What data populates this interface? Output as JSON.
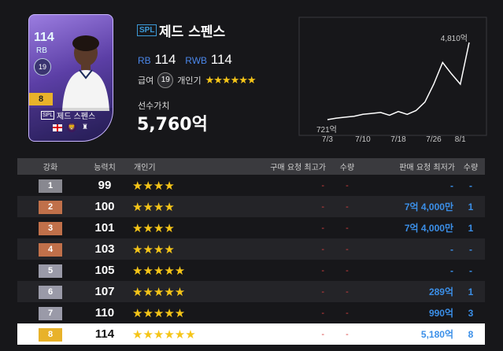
{
  "player": {
    "ovr": "114",
    "pos": "RB",
    "pay": "19",
    "grade": "8",
    "season": "SPL",
    "name": "제드 스펜스",
    "positions": [
      {
        "label": "RB",
        "value": "114"
      },
      {
        "label": "RWB",
        "value": "114"
      }
    ],
    "pay_label": "급여",
    "popularity_label": "개인기",
    "popularity_stars": "★★★★★★",
    "value_label": "선수가치",
    "value": "5,760억",
    "icons": [
      "england-flag-icon",
      "premier-league-icon",
      "tottenham-crest-icon"
    ]
  },
  "chart_data": {
    "type": "line",
    "x": [
      "7/3",
      "7/5",
      "7/7",
      "7/9",
      "7/10",
      "7/12",
      "7/14",
      "7/16",
      "7/18",
      "7/20",
      "7/22",
      "7/24",
      "7/26",
      "7/28",
      "7/30",
      "8/1",
      "8/2"
    ],
    "values": [
      721,
      800,
      850,
      900,
      1000,
      1050,
      1100,
      950,
      1150,
      1000,
      1200,
      1650,
      2600,
      3750,
      3150,
      2600,
      4810
    ],
    "xticks": [
      "7/3",
      "7/10",
      "7/18",
      "7/26",
      "8/1"
    ],
    "annotations": [
      {
        "label": "721억"
      },
      {
        "label": "4,810억"
      }
    ],
    "line_color": "#ffffff",
    "ylim": [
      0,
      5200
    ],
    "grid": false
  },
  "table": {
    "headers": [
      "강화",
      "능력치",
      "개인기",
      "구매 요청 최고가",
      "수량",
      "판매 요청 최저가",
      "수량"
    ],
    "rows": [
      {
        "grade": "1",
        "color": "#888890",
        "ability": "99",
        "stars": "★★★★",
        "buy": "-",
        "buy_qty": "-",
        "sell": "-",
        "sell_qty": "-"
      },
      {
        "grade": "2",
        "color": "#c0704a",
        "ability": "100",
        "stars": "★★★★",
        "buy": "-",
        "buy_qty": "-",
        "sell": "7억 4,000만",
        "sell_qty": "1"
      },
      {
        "grade": "3",
        "color": "#c0704a",
        "ability": "101",
        "stars": "★★★★",
        "buy": "-",
        "buy_qty": "-",
        "sell": "7억 4,000만",
        "sell_qty": "1"
      },
      {
        "grade": "4",
        "color": "#c0704a",
        "ability": "103",
        "stars": "★★★★",
        "buy": "-",
        "buy_qty": "-",
        "sell": "-",
        "sell_qty": "-"
      },
      {
        "grade": "5",
        "color": "#9a9aa8",
        "ability": "105",
        "stars": "★★★★★",
        "buy": "-",
        "buy_qty": "-",
        "sell": "-",
        "sell_qty": "-"
      },
      {
        "grade": "6",
        "color": "#9a9aa8",
        "ability": "107",
        "stars": "★★★★★",
        "buy": "-",
        "buy_qty": "-",
        "sell": "289억",
        "sell_qty": "1"
      },
      {
        "grade": "7",
        "color": "#9a9aa8",
        "ability": "110",
        "stars": "★★★★★",
        "buy": "-",
        "buy_qty": "-",
        "sell": "990억",
        "sell_qty": "3"
      },
      {
        "grade": "8",
        "color": "#e8b22a",
        "ability": "114",
        "stars": "★★★★★★",
        "buy": "-",
        "buy_qty": "-",
        "sell": "5,180억",
        "sell_qty": "8",
        "selected": true
      }
    ]
  }
}
